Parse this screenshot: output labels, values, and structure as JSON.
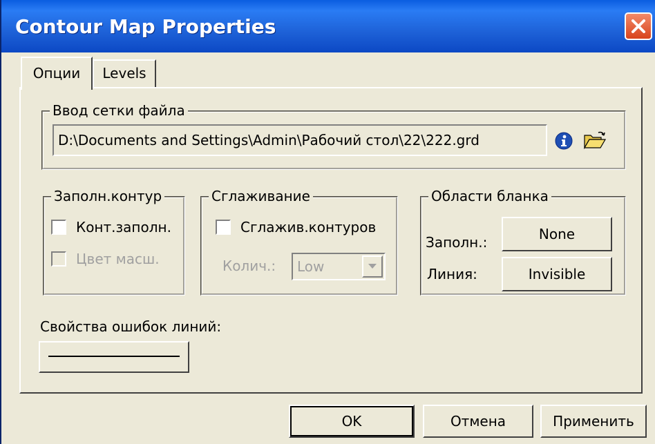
{
  "window": {
    "title": "Contour Map Properties"
  },
  "tabs": [
    {
      "label": "Опции",
      "active": true
    },
    {
      "label": "Levels",
      "active": false
    }
  ],
  "grid_input": {
    "legend": "Ввод сетки файла",
    "path": "D:\\Documents and Settings\\Admin\\Рабочий стол\\22\\222.grd",
    "info_icon": "info-icon",
    "open_icon": "open-folder-icon"
  },
  "fill_contours": {
    "legend": "Заполн.контур",
    "fill_label": "Конт.заполн.",
    "fill_checked": false,
    "color_scale_label": "Цвет масш.",
    "color_scale_checked": false
  },
  "smoothing": {
    "legend": "Сглаживание",
    "smooth_label": "Сглажив.контуров",
    "smooth_checked": false,
    "amount_label": "Колич.:",
    "amount_value": "Low"
  },
  "blanked_regions": {
    "legend": "Области бланка",
    "fill_label": "Заполн.:",
    "fill_value": "None",
    "line_label": "Линия:",
    "line_value": "Invisible"
  },
  "fault_line": {
    "label": "Свойства ошибок линий:"
  },
  "buttons": {
    "ok": "OK",
    "cancel": "Отмена",
    "apply": "Применить"
  },
  "colors": {
    "title_bar": "#0a5de0",
    "close_button": "#d8441c",
    "face": "#ece9d8"
  }
}
